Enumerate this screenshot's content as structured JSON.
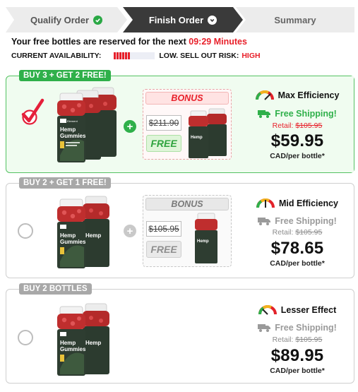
{
  "steps": [
    {
      "label": "Qualify Order",
      "icon": "check-icon"
    },
    {
      "label": "Finish Order",
      "icon": "chevron-down-icon"
    },
    {
      "label": "Summary"
    }
  ],
  "reserve": {
    "text": "Your free bottles are reserved for the next",
    "timer": "09:29 Minutes"
  },
  "availability": {
    "label": "CURRENT AVAILABILITY:",
    "level": 0.4,
    "status": "LOW. SELL OUT RISK:",
    "risk": "HIGH"
  },
  "offers": [
    {
      "tag": "BUY 3 + GET 2 FREE!",
      "selected": true,
      "main_bottles": 3,
      "bonus_label": "BONUS",
      "bonus_old_price": "$211.90",
      "bonus_free": "FREE",
      "bonus_bottles": 2,
      "efficiency": "Max Efficiency",
      "efficiency_level": "max",
      "shipping": "Free Shipping!",
      "retail_label": "Retail:",
      "retail_price": "$105.95",
      "price": "$59.95",
      "per": "CAD/per bottle*"
    },
    {
      "tag": "BUY 2 + GET 1 FREE!",
      "selected": false,
      "main_bottles": 2,
      "bonus_label": "BONUS",
      "bonus_old_price": "$105.95",
      "bonus_free": "FREE",
      "bonus_bottles": 1,
      "efficiency": "Mid Efficiency",
      "efficiency_level": "mid",
      "shipping": "Free Shipping!",
      "retail_label": "Retail:",
      "retail_price": "$105.95",
      "price": "$78.65",
      "per": "CAD/per bottle*"
    },
    {
      "tag": "BUY 2 BOTTLES",
      "selected": false,
      "main_bottles": 2,
      "efficiency": "Lesser Effect",
      "efficiency_level": "low",
      "shipping": "Free Shipping!",
      "retail_label": "Retail:",
      "retail_price": "$105.95",
      "price": "$89.95",
      "per": "CAD/per bottle*"
    }
  ],
  "product": {
    "brand": "Element Organics",
    "name_line1": "Hemp",
    "name_line2": "Gummies"
  },
  "colors": {
    "accent_green": "#2fb04a",
    "alert_red": "#e8202a",
    "step_active": "#3a3a3a"
  }
}
